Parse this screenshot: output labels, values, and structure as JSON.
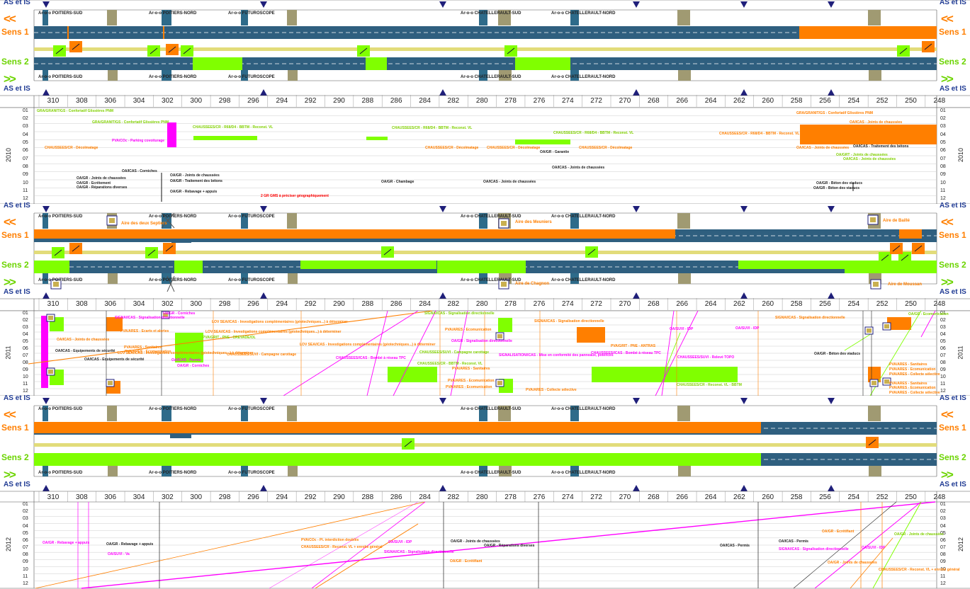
{
  "colors": {
    "road": "#2f5f7f",
    "orange": "#ff7f00",
    "green": "#80ff00",
    "magenta": "#ff00ff",
    "navy": "#1f1f7a",
    "khaki": "#a09a72",
    "median": "#e2dc7a",
    "teal": "#2e6b8a"
  },
  "labels": {
    "asis": "AS et IS",
    "sens1": "Sens 1",
    "sens2": "Sens 2",
    "left_arrows": "<<",
    "right_arrows": ">>",
    "note_gms": "2 GR GMS à préciser géographiquement"
  },
  "years": [
    "2010",
    "2011",
    "2012"
  ],
  "months": [
    "01",
    "02",
    "03",
    "04",
    "05",
    "06",
    "07",
    "08",
    "09",
    "10",
    "11",
    "12"
  ],
  "scale_ticks": [
    "310",
    "308",
    "306",
    "304",
    "302",
    "300",
    "298",
    "296",
    "294",
    "292",
    "290",
    "288",
    "286",
    "284",
    "282",
    "280",
    "278",
    "276",
    "274",
    "272",
    "270",
    "268",
    "266",
    "264",
    "262",
    "260",
    "258",
    "256",
    "254",
    "252",
    "250",
    "248"
  ],
  "places": [
    {
      "x": "54",
      "text": "Ar-o-o POITIERS-SUD"
    },
    {
      "x": "210",
      "text": "Ar-o-o POITIERS-NORD"
    },
    {
      "x": "322",
      "text": "Ar-o-o FUTUROSCOPE"
    },
    {
      "x": "650",
      "text": "Ar-o-o CHATELLERAULT-SUD"
    },
    {
      "x": "778",
      "text": "Ar-o-o CHATELLERAULT-NORD"
    }
  ],
  "areas": [
    {
      "name": "Aire des deux Septiers"
    },
    {
      "name": "Aire des Meuniers"
    },
    {
      "name": "Aire de Baillé"
    },
    {
      "name": "Aire de Chagnon"
    },
    {
      "name": "Aire de Moussan"
    }
  ],
  "ann_2010": [
    {
      "c": "#80d000",
      "t": "GRA/GRANIT/GS - Confortatif Glissières PNM"
    },
    {
      "c": "#80d000",
      "t": "GRA/GRANIT/GS - Confortatif Glissières PNM"
    },
    {
      "c": "#ff7f00",
      "t": "CHAUSSEES/CR - Décolmatage"
    },
    {
      "c": "#ff00ff",
      "t": "PVA/COc - Parking covoiturage"
    },
    {
      "c": "#80d000",
      "t": "CHAUSSEES/CR - R68/D4 - BBTM - Reconst. VL"
    },
    {
      "c": "#80d000",
      "t": "CHAUSSEES/CR - R68/D4 - BBTM - Reconst. VL"
    },
    {
      "c": "#ff7f00",
      "t": "CHAUSSEES/CR - Décolmatage"
    },
    {
      "c": "#ff7f00",
      "t": "CHAUSSEES/CR - Décolmatage"
    },
    {
      "c": "#ff7f00",
      "t": "CHAUSSEES/CR - Décolmatage"
    },
    {
      "c": "#80d000",
      "t": "CHAUSSEES/CR - R68/D4 - BBTM - Reconst. VL"
    },
    {
      "c": "#222222",
      "t": "OA/GR - Garantie"
    },
    {
      "c": "#ff7f00",
      "t": "GRA/GRANIT/GS - Confortatif Glissières PNM"
    },
    {
      "c": "#ff7f00",
      "t": "CHAUSSEES/CR - R68/D4 - BBTM - Reconst. VL"
    },
    {
      "c": "#ff7f00",
      "t": "OA/ICAS - Joints de chaussées"
    },
    {
      "c": "#ff7f00",
      "t": "OA/ICAS - Joints de chaussées"
    },
    {
      "c": "#222222",
      "t": "OA/ICAS - Traitement des bétons"
    },
    {
      "c": "#80d000",
      "t": "OA/GRT - Joints de chaussées"
    },
    {
      "c": "#80d000",
      "t": "OA/ICAS - Joints de chaussées"
    },
    {
      "c": "#222222",
      "t": "OA/ICAS - Corniches"
    },
    {
      "c": "#222222",
      "t": "OA/GR - Joints de chaussées"
    },
    {
      "c": "#222222",
      "t": "OA/GR - Traitement des bétons"
    },
    {
      "c": "#222222",
      "t": "OA/GR - Ecrêtement"
    },
    {
      "c": "#222222",
      "t": "OA/GR - Réparations diverses"
    },
    {
      "c": "#222222",
      "t": "OA/GR - Joints de chaussées"
    },
    {
      "c": "#222222",
      "t": "OA/GR - Rebavage + appuis"
    },
    {
      "c": "#222222",
      "t": "OA/GR - Chambage"
    },
    {
      "c": "#222222",
      "t": "OA/ICAS - Joints de chaussées"
    },
    {
      "c": "#222222",
      "t": "OA/ICAS - Joints de chaussées"
    },
    {
      "c": "#222222",
      "t": "OA/GR - Béton des viaducs"
    },
    {
      "c": "#222222",
      "t": "OA/GR - Béton des viaducs"
    }
  ],
  "ann_2011": [
    {
      "c": "#ff00ff",
      "t": "SIGNA/ICAS - Signalisation directionnelle"
    },
    {
      "c": "#ff00ff",
      "t": "OA/GR - Corniches"
    },
    {
      "c": "#ff7f00",
      "t": "LOV SEA/ICAS - Investigations complémentaires (géotechniques...) à déterminer"
    },
    {
      "c": "#ff7f00",
      "t": "LOV SEA/ICAS - Investigations complémentaires (géotechniques...) à déterminer"
    },
    {
      "c": "#80d000",
      "t": "PVA/GRIT - PNE - CREVADE/OL"
    },
    {
      "c": "#ff7f00",
      "t": "PVA/ARES - Ecarts et alertes"
    },
    {
      "c": "#ff7f00",
      "t": "OA/ICAS - Joints de chaussées"
    },
    {
      "c": "#ff7f00",
      "t": "PVA/ARES - Sanitaires"
    },
    {
      "c": "#ff7f00",
      "t": "PVA/ARES - Ecomunication"
    },
    {
      "c": "#222222",
      "t": "OA/ICAS - Equipements de sécurité"
    },
    {
      "c": "#222222",
      "t": "OA/ICAS - Equipements de sécurité"
    },
    {
      "c": "#ff7f00",
      "t": "LOV SEA/ICAS - Investigations complémentaires (géotechniques...) à déterminer"
    },
    {
      "c": "#ff00ff",
      "t": "OA/ICAS - Permis"
    },
    {
      "c": "#ff00ff",
      "t": "OA/GR - Corniches"
    },
    {
      "c": "#ff7f00",
      "t": "CHAUSSEES/SUVI - Campagne carottage"
    },
    {
      "c": "#ff7f00",
      "t": "LOV SEA/ICAS - Investigations complémentaires (géotechniques...) à déterminer"
    },
    {
      "c": "#ff00ff",
      "t": "CHAUSSEES/ICAS - Bombé à réseau TPC"
    },
    {
      "c": "#80d000",
      "t": "SIGNA/ICAS - Signalisation directionnelle"
    },
    {
      "c": "#ff7f00",
      "t": "PVA/ARES - Ecomunication"
    },
    {
      "c": "#ff00ff",
      "t": "OA/GR - Signalisation directionnelle"
    },
    {
      "c": "#80d000",
      "t": "CHAUSSEES/SUVI - Campagne carottage"
    },
    {
      "c": "#80d000",
      "t": "CHAUSSEES/CR - BBTM - Reconst. VL"
    },
    {
      "c": "#ff7f00",
      "t": "PVA/ARES - Sanitaires"
    },
    {
      "c": "#ff7f00",
      "t": "PVA/ARES - Ecomunication"
    },
    {
      "c": "#ff7f00",
      "t": "PVA/ARES - Collecte sélective"
    },
    {
      "c": "#ff00ff",
      "t": "SIGNALISATION/ICAS - Mise en conformité des panneaux, potences"
    },
    {
      "c": "#ff7f00",
      "t": "PVA/ARES - Ecomunication"
    },
    {
      "c": "#ff7f00",
      "t": "SIGNA/ICAS - Signalisation directionnelle"
    },
    {
      "c": "#ff7f00",
      "t": "PVA/GRIT - PNE - ANTRAS"
    },
    {
      "c": "#ff00ff",
      "t": "CHAUSSEES/ICAS - Bombé à réseau TPC"
    },
    {
      "c": "#ff00ff",
      "t": "OA/SUVI - IDP"
    },
    {
      "c": "#ff00ff",
      "t": "CHAUSSEES/SUVI - Relevé TOPO"
    },
    {
      "c": "#80d000",
      "t": "CHAUSSEES/CR - Reconst. VL - BBTM"
    },
    {
      "c": "#ff00ff",
      "t": "OA/SUVI - IDP"
    },
    {
      "c": "#ff7f00",
      "t": "SIGNA/ICAS - Signalisation directionnelle"
    },
    {
      "c": "#222222",
      "t": "OA/GR - Béton des viaducs"
    },
    {
      "c": "#80d000",
      "t": "OA/GR - Ecomunication"
    },
    {
      "c": "#ff7f00",
      "t": "PVA/ARES - Sanitaires"
    },
    {
      "c": "#ff7f00",
      "t": "PVA/ARES - Ecomunication"
    },
    {
      "c": "#ff7f00",
      "t": "PVA/ARES - Collecte sélective"
    },
    {
      "c": "#ff7f00",
      "t": "PVA/ARES - Sanitaires"
    },
    {
      "c": "#ff7f00",
      "t": "PVA/ARES - Ecomunication"
    },
    {
      "c": "#ff7f00",
      "t": "PVA/ARES - Collecte sélective"
    }
  ],
  "ann_2012": [
    {
      "c": "#ff00ff",
      "t": "OA/GR - Rebavage + appuis"
    },
    {
      "c": "#222222",
      "t": "OA/GR - Rebavage + appuis"
    },
    {
      "c": "#ff00ff",
      "t": "OA/SUVI - Va"
    },
    {
      "c": "#ff7f00",
      "t": "PVA/COc - Pl. interdiction doublés"
    },
    {
      "c": "#ff7f00",
      "t": "CHAUSSEES/CR - Reconst. VL + enrobé général"
    },
    {
      "c": "#ff00ff",
      "t": "OA/SUVI - IDP"
    },
    {
      "c": "#ff00ff",
      "t": "SIGNA/ICAS - Signalisation directionnelle"
    },
    {
      "c": "#222222",
      "t": "OA/GR - Joints de chaussées"
    },
    {
      "c": "#222222",
      "t": "OA/GR - Réparations diverses"
    },
    {
      "c": "#ff7f00",
      "t": "OA/GR - Ecrétifiant"
    },
    {
      "c": "#222222",
      "t": "OA/ICAS - Permis"
    },
    {
      "c": "#222222",
      "t": "OA/ICAS - Permis"
    },
    {
      "c": "#ff00ff",
      "t": "SIGNA/ICAS - Signalisation directionnelle"
    },
    {
      "c": "#ff7f00",
      "t": "OA/GR - Ecrétifiant"
    },
    {
      "c": "#ff00ff",
      "t": "OA/SUVI - IDP"
    },
    {
      "c": "#80d000",
      "t": "OA/GR - Joints de chaussées"
    },
    {
      "c": "#ff7f00",
      "t": "OA/GR - Joints de chaussées"
    },
    {
      "c": "#ff7f00",
      "t": "CHAUSSEES/CR - Reconst. VL + enrobé général"
    }
  ]
}
